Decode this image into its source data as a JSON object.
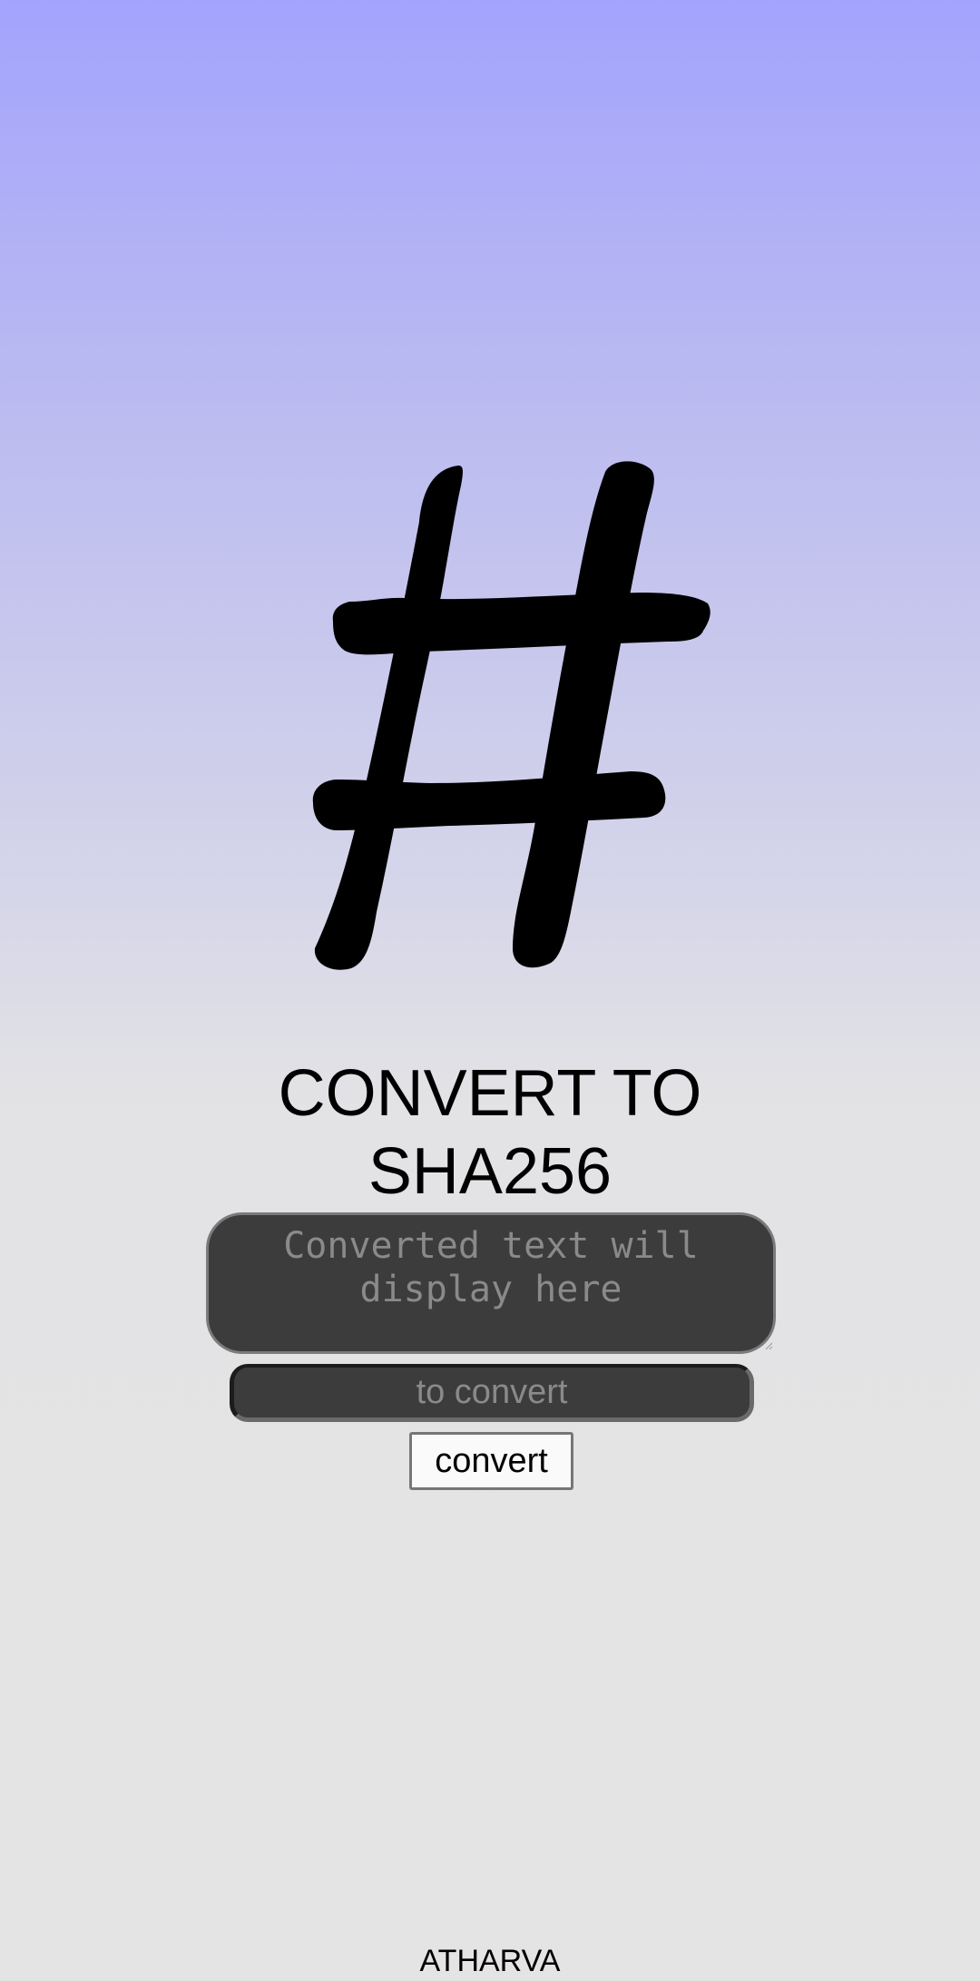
{
  "header": {
    "logo_icon": "hash-icon",
    "title_line1": "CONVERT TO",
    "title_line2": "SHA256"
  },
  "form": {
    "output_placeholder": "Converted text will display here",
    "input_placeholder": "to convert",
    "convert_label": "convert"
  },
  "footer": {
    "author": "ATHARVA"
  },
  "colors": {
    "gradient_top": "#a3a3fd",
    "background": "#e4e4e4",
    "field_background": "#3c3c3c",
    "placeholder_text": "#8a8a8a"
  }
}
